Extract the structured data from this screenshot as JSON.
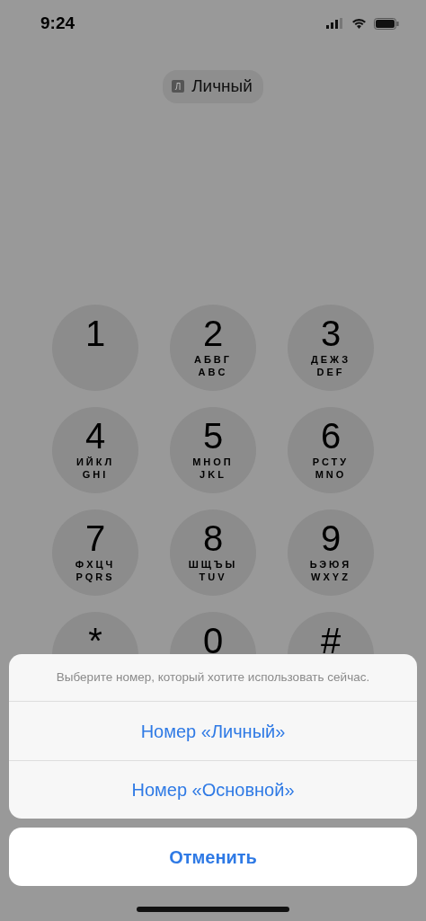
{
  "status_bar": {
    "time": "9:24"
  },
  "line_badge": {
    "letter": "Л",
    "label": "Личный"
  },
  "keypad": [
    {
      "digit": "1"
    },
    {
      "digit": "2",
      "letters": [
        "АБВГ",
        "ABC"
      ]
    },
    {
      "digit": "3",
      "letters": [
        "ДЕЖЗ",
        "DEF"
      ]
    },
    {
      "digit": "4",
      "letters": [
        "ИЙКЛ",
        "GHI"
      ]
    },
    {
      "digit": "5",
      "letters": [
        "МНОП",
        "JKL"
      ]
    },
    {
      "digit": "6",
      "letters": [
        "РСТУ",
        "MNO"
      ]
    },
    {
      "digit": "7",
      "letters": [
        "ФХЦЧ",
        "PQRS"
      ]
    },
    {
      "digit": "8",
      "letters": [
        "ШЩЪЫ",
        "TUV"
      ]
    },
    {
      "digit": "9",
      "letters": [
        "ЬЭЮЯ",
        "WXYZ"
      ]
    },
    {
      "digit": "*"
    },
    {
      "digit": "0"
    },
    {
      "digit": "#"
    }
  ],
  "action_sheet": {
    "message": "Выберите номер, который хотите использовать сейчас.",
    "actions": [
      "Номер «Личный»",
      "Номер «Основной»"
    ],
    "cancel": "Отменить"
  }
}
